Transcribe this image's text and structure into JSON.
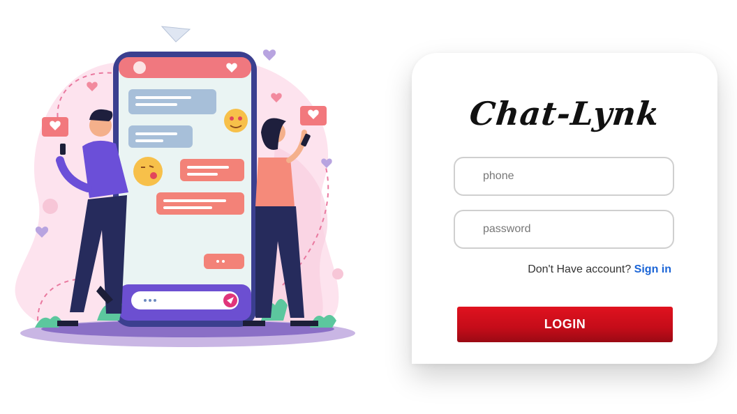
{
  "brand": {
    "title": "Chat-Lynk"
  },
  "form": {
    "phone_placeholder": "phone",
    "password_placeholder": "password",
    "signup_prompt": "Don't Have account?",
    "signup_link": "Sign in",
    "login_label": "LOGIN"
  },
  "colors": {
    "login_button": "#d0101b",
    "link": "#1a64d6",
    "card_bg": "#ffffff"
  }
}
